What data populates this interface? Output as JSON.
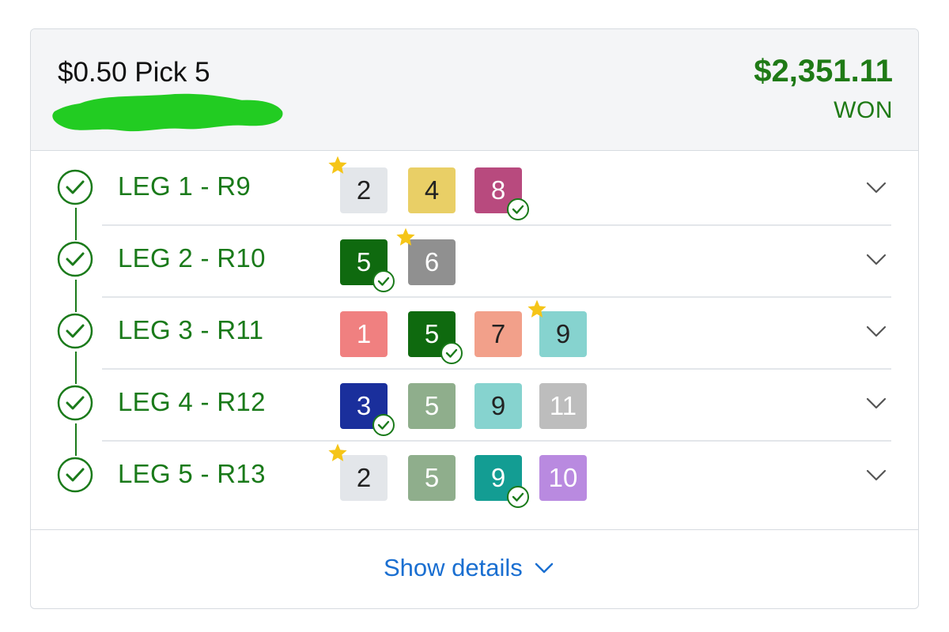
{
  "ticket": {
    "title": "$0.50 Pick 5",
    "amount": "$2,351.11",
    "status": "WON"
  },
  "legs": [
    {
      "label": "LEG 1 - R9",
      "selections": [
        {
          "number": "2",
          "bg": "#e3e6ea",
          "fg": "#222222",
          "favorite": true,
          "winner": false
        },
        {
          "number": "4",
          "bg": "#e9cf66",
          "fg": "#222222",
          "favorite": false,
          "winner": false
        },
        {
          "number": "8",
          "bg": "#b84a7e",
          "fg": "#ffffff",
          "favorite": false,
          "winner": true
        }
      ]
    },
    {
      "label": "LEG 2 - R10",
      "selections": [
        {
          "number": "5",
          "bg": "#0f6a0f",
          "fg": "#ffffff",
          "favorite": false,
          "winner": true
        },
        {
          "number": "6",
          "bg": "#909090",
          "fg": "#ffffff",
          "favorite": true,
          "winner": false
        }
      ]
    },
    {
      "label": "LEG 3 - R11",
      "selections": [
        {
          "number": "1",
          "bg": "#f08080",
          "fg": "#ffffff",
          "favorite": false,
          "winner": false
        },
        {
          "number": "5",
          "bg": "#0f6a0f",
          "fg": "#ffffff",
          "favorite": false,
          "winner": true
        },
        {
          "number": "7",
          "bg": "#f2a08a",
          "fg": "#222222",
          "favorite": false,
          "winner": false
        },
        {
          "number": "9",
          "bg": "#86d3cf",
          "fg": "#222222",
          "favorite": true,
          "winner": false
        }
      ]
    },
    {
      "label": "LEG 4 - R12",
      "selections": [
        {
          "number": "3",
          "bg": "#1a2f9c",
          "fg": "#ffffff",
          "favorite": false,
          "winner": true
        },
        {
          "number": "5",
          "bg": "#8fae8c",
          "fg": "#ffffff",
          "favorite": false,
          "winner": false
        },
        {
          "number": "9",
          "bg": "#86d3cf",
          "fg": "#222222",
          "favorite": false,
          "winner": false
        },
        {
          "number": "11",
          "bg": "#bdbdbd",
          "fg": "#ffffff",
          "favorite": false,
          "winner": false
        }
      ]
    },
    {
      "label": "LEG 5 - R13",
      "selections": [
        {
          "number": "2",
          "bg": "#e3e6ea",
          "fg": "#222222",
          "favorite": true,
          "winner": false
        },
        {
          "number": "5",
          "bg": "#8fae8c",
          "fg": "#ffffff",
          "favorite": false,
          "winner": false
        },
        {
          "number": "9",
          "bg": "#139d93",
          "fg": "#ffffff",
          "favorite": false,
          "winner": true
        },
        {
          "number": "10",
          "bg": "#b98ae0",
          "fg": "#ffffff",
          "favorite": false,
          "winner": false
        }
      ]
    }
  ],
  "footer": {
    "show_details_label": "Show details"
  },
  "colors": {
    "win_green": "#1a7a1a",
    "amount_green": "#1f7a16",
    "link_blue": "#1a6fd1",
    "star_gold": "#f5c518"
  },
  "icons": {
    "leg_status": "check-circle-icon",
    "expand": "chevron-down-icon",
    "favorite": "star-icon",
    "winner": "check-badge-icon"
  }
}
